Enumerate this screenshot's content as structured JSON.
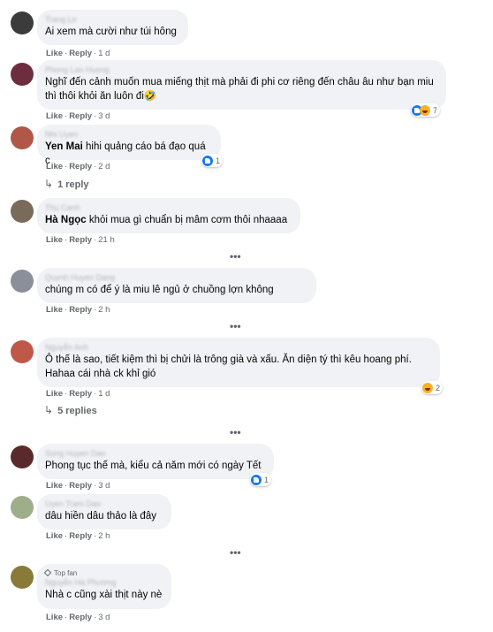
{
  "comments": [
    {
      "author": "Trang Le",
      "text": "Ai xem mà cười như túi hông",
      "like": "Like",
      "reply": "Reply",
      "time": "1 d",
      "avatar_color": "#3b3b3b"
    },
    {
      "author": "Phong Lan Huong",
      "text": "Nghĩ đến cảnh muốn mua miếng thịt mà phải đi phi cơ riêng đến châu âu như bạn miu thì thôi khỏi ăn luôn đi🤣",
      "like": "Like",
      "reply": "Reply",
      "time": "3 d",
      "reactions": "7",
      "avatar_color": "#6e2d3f"
    },
    {
      "author": "Nhi Uyen",
      "tag": "Yen Mai",
      "text": " hihi quảng cáo bá đạo quá c",
      "like": "Like",
      "reply": "Reply",
      "time": "2 d",
      "reactions": "1",
      "replies": "1 reply",
      "avatar_color": "#b0574a"
    },
    {
      "author": "Thu Canh",
      "tag": "Hà Ngọc",
      "text": " khỏi mua gì chuẩn bị mâm cơm thôi nhaaaa",
      "like": "Like",
      "reply": "Reply",
      "time": "21 h",
      "avatar_color": "#7a6a5a"
    },
    {
      "author": "Quynh Huyen Dang",
      "text": "chúng m có để ý là miu lê ngủ ở chuồng lợn không",
      "like": "Like",
      "reply": "Reply",
      "time": "2 h",
      "avatar_color": "#8a8f9a"
    },
    {
      "author": "Nguyễn Anh",
      "text": "Ô thế là sao, tiết kiệm thì bị chửi là trông già và xấu. Ăn diện tý thì kêu hoang phí. Hahaa cái nhà ck khỉ gió",
      "like": "Like",
      "reply": "Reply",
      "time": "1 d",
      "reactions": "2",
      "replies": "5 replies",
      "avatar_color": "#c0584a"
    },
    {
      "author": "Song Huyen Dao",
      "text": "Phong tục thế mà, kiểu cả năm mới có ngày Tết",
      "like": "Like",
      "reply": "Reply",
      "time": "3 d",
      "reactions": "1",
      "avatar_color": "#5a2a2a"
    },
    {
      "author": "Uyen Tram Dao",
      "text": "dâu hiền dâu thảo là đây",
      "like": "Like",
      "reply": "Reply",
      "time": "2 h",
      "avatar_color": "#9fae8a"
    },
    {
      "author": "Nguyễn Hà Phương",
      "badge": "Top fan",
      "text": "Nhà c cũng xài thịt này nè",
      "like": "Like",
      "reply": "Reply",
      "time": "3 d",
      "avatar_color": "#8a7a3a"
    }
  ],
  "more_dots": "•••",
  "reply_arrow": "↳",
  "separator": "·"
}
